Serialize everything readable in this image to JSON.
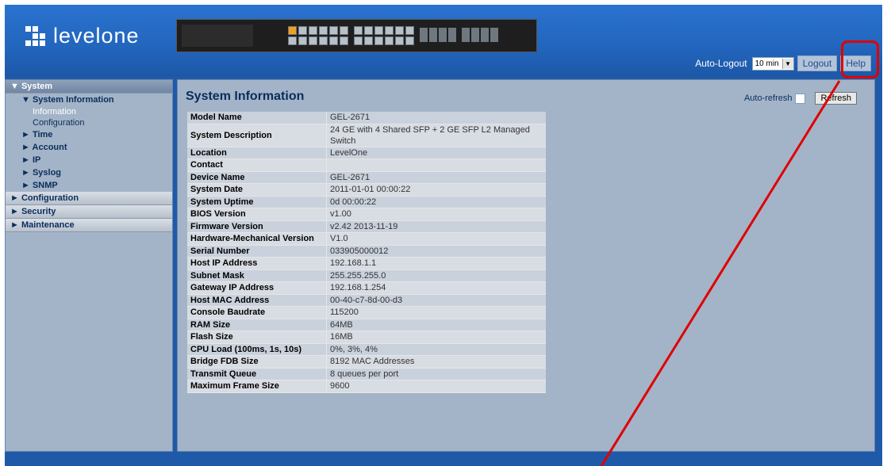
{
  "brand": {
    "name": "levelone"
  },
  "header": {
    "autologout_label": "Auto-Logout",
    "autologout_value": "10 min",
    "logout_label": "Logout",
    "help_label": "Help"
  },
  "nav": {
    "system": "▼ System",
    "system_information": "▼ System Information",
    "information": "Information",
    "configuration_leaf": "Configuration",
    "time": "► Time",
    "account": "► Account",
    "ip": "► IP",
    "syslog": "► Syslog",
    "snmp": "► SNMP",
    "configuration": "► Configuration",
    "security": "► Security",
    "maintenance": "► Maintenance"
  },
  "content": {
    "title": "System Information",
    "autorefresh_label": "Auto-refresh",
    "refresh_label": "Refresh",
    "rows": [
      {
        "k": "Model Name",
        "v": "GEL-2671"
      },
      {
        "k": "System Description",
        "v": "24 GE with 4 Shared SFP + 2 GE SFP L2 Managed Switch"
      },
      {
        "k": "Location",
        "v": "LevelOne"
      },
      {
        "k": "Contact",
        "v": ""
      },
      {
        "k": "Device Name",
        "v": "GEL-2671"
      },
      {
        "k": "System Date",
        "v": "2011-01-01 00:00:22"
      },
      {
        "k": "System Uptime",
        "v": "0d 00:00:22"
      },
      {
        "k": "BIOS Version",
        "v": "v1.00"
      },
      {
        "k": "Firmware Version",
        "v": "v2.42 2013-11-19"
      },
      {
        "k": "Hardware-Mechanical Version",
        "v": "V1.0"
      },
      {
        "k": "Serial Number",
        "v": "033905000012"
      },
      {
        "k": "Host IP Address",
        "v": "192.168.1.1"
      },
      {
        "k": "Subnet Mask",
        "v": "255.255.255.0"
      },
      {
        "k": "Gateway IP Address",
        "v": "192.168.1.254"
      },
      {
        "k": "Host MAC Address",
        "v": "00-40-c7-8d-00-d3"
      },
      {
        "k": "Console Baudrate",
        "v": "115200"
      },
      {
        "k": "RAM Size",
        "v": "64MB"
      },
      {
        "k": "Flash Size",
        "v": "16MB"
      },
      {
        "k": "CPU Load (100ms, 1s, 10s)",
        "v": "0%, 3%, 4%"
      },
      {
        "k": "Bridge FDB Size",
        "v": "8192 MAC Addresses"
      },
      {
        "k": "Transmit Queue",
        "v": "8 queues per port"
      },
      {
        "k": "Maximum Frame Size",
        "v": "9600"
      }
    ]
  },
  "colors": {
    "annotation": "#e00000",
    "header_blue": "#2265bd",
    "panel": "#a3b4c8"
  },
  "icons": {
    "logo": "levelone-logo-icon",
    "device": "switch-device-icon",
    "select_arrow": "dropdown-arrow-icon"
  }
}
